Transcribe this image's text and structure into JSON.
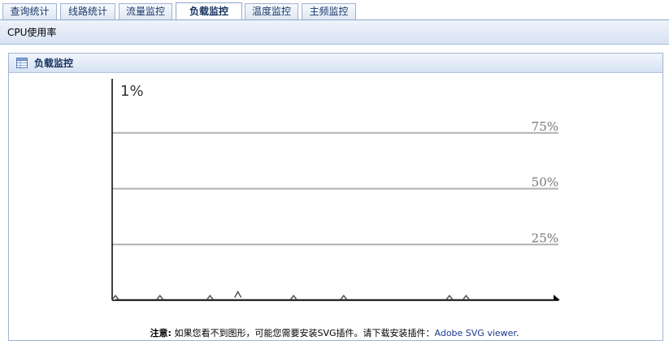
{
  "tabs": [
    {
      "label": "查询统计",
      "active": false
    },
    {
      "label": "线路统计",
      "active": false
    },
    {
      "label": "流量监控",
      "active": false
    },
    {
      "label": "负载监控",
      "active": true
    },
    {
      "label": "温度监控",
      "active": false
    },
    {
      "label": "主频监控",
      "active": false
    }
  ],
  "subbar": {
    "title": "CPU使用率"
  },
  "panel": {
    "title": "负载监控",
    "icon": "table-icon"
  },
  "chart_data": {
    "type": "line",
    "current_value_label": "1%",
    "ylim": [
      0,
      100
    ],
    "gridlines": [
      {
        "value": 75,
        "label": "75%"
      },
      {
        "value": 50,
        "label": "50%"
      },
      {
        "value": 25,
        "label": "25%"
      }
    ],
    "series": [
      {
        "values": [
          1,
          1,
          1,
          1,
          1,
          1,
          1,
          1,
          1,
          1,
          1,
          1,
          1,
          1,
          1,
          1,
          1,
          1,
          1,
          1,
          1,
          1,
          1,
          1,
          1,
          1,
          1,
          1,
          1,
          1,
          1,
          1,
          1,
          1,
          1,
          1,
          1,
          1,
          1,
          1,
          1,
          1,
          1,
          1,
          1,
          1,
          1,
          1,
          1,
          1,
          1,
          1,
          1,
          1,
          1,
          1,
          1,
          1,
          1,
          1,
          1,
          1,
          1,
          1,
          1,
          1,
          1,
          1,
          1,
          1,
          1,
          1,
          1,
          1,
          1,
          1,
          1,
          1,
          1,
          1
        ]
      }
    ],
    "spikes": [
      {
        "index": 0,
        "value": 1
      },
      {
        "index": 8,
        "value": 1
      },
      {
        "index": 17,
        "value": 1
      },
      {
        "index": 22,
        "value": 2
      },
      {
        "index": 32,
        "value": 1
      },
      {
        "index": 41,
        "value": 1
      },
      {
        "index": 60,
        "value": 1
      },
      {
        "index": 63,
        "value": 1
      }
    ],
    "grid": true
  },
  "note": {
    "prefix": "注意:",
    "text": " 如果您看不到图形，可能您需要安装SVG插件。请下载安装插件：",
    "link": "Adobe SVG viewer",
    "suffix": "."
  },
  "colors": {
    "tab_text": "#1a3a6b",
    "gridline": "#b0b0b0",
    "axis": "#000000"
  }
}
